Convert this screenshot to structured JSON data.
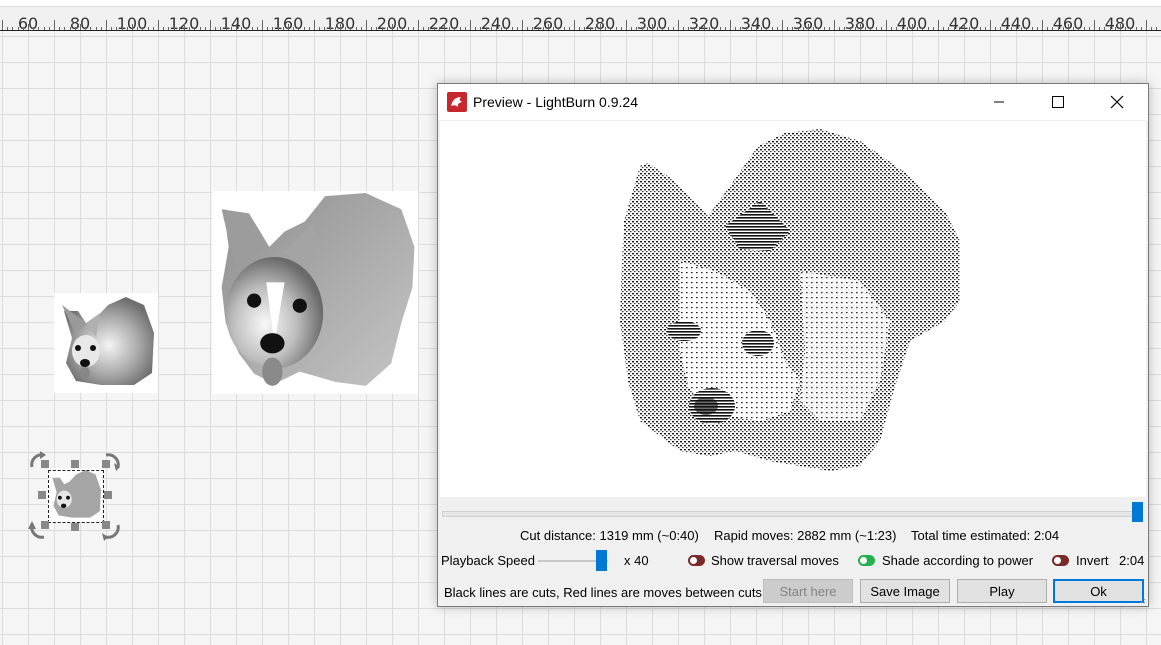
{
  "ruler": {
    "labels": [
      "60",
      "80",
      "100",
      "120",
      "140",
      "160",
      "180",
      "200",
      "220",
      "240",
      "260",
      "280",
      "300",
      "320",
      "340",
      "360",
      "380",
      "400",
      "420",
      "440",
      "460",
      "480"
    ]
  },
  "canvas": {
    "objects": [
      "corgi-image-small",
      "corgi-image-large",
      "corgi-image-selected"
    ]
  },
  "preview_window": {
    "title": "Preview - LightBurn 0.9.24",
    "stats": {
      "cut_distance": "Cut distance: 1319 mm (~0:40)",
      "rapid_moves": "Rapid moves: 2882 mm (~1:23)",
      "total_time": "Total time estimated: 2:04"
    },
    "playback": {
      "label": "Playback Speed",
      "multiplier": "x 40",
      "speed_fraction": 0.9
    },
    "toggles": {
      "show_traversal": {
        "label": "Show traversal moves",
        "on": false
      },
      "shade_power": {
        "label": "Shade according to power",
        "on": true
      },
      "invert": {
        "label": "Invert",
        "on": false
      }
    },
    "current_time": "2:04",
    "timeline_fraction": 1.0,
    "hint": "Black lines are cuts, Red lines are moves between cuts",
    "buttons": {
      "start_here": "Start here",
      "save_image": "Save Image",
      "play": "Play",
      "ok": "Ok"
    }
  },
  "colors": {
    "accent": "#0078d7",
    "toggle_off": "#7a2a2a",
    "toggle_on": "#22b14c",
    "app_icon": "#c8282d"
  }
}
